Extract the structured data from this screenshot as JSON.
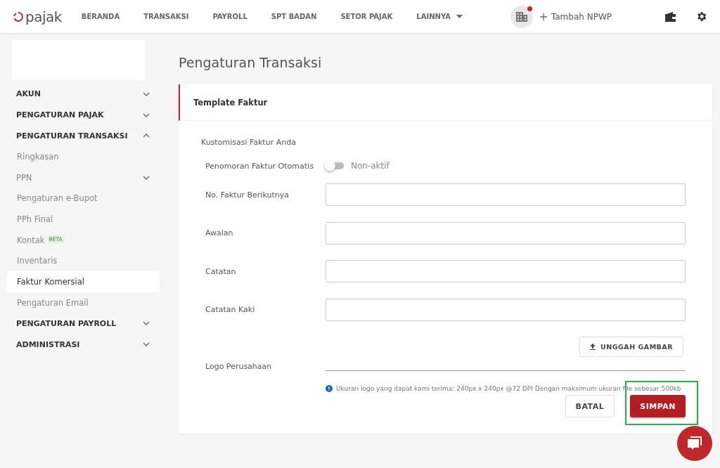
{
  "navbar": {
    "brand": "pajak",
    "menu": [
      {
        "label": "BERANDA",
        "dropdown": false
      },
      {
        "label": "TRANSAKSI",
        "dropdown": false
      },
      {
        "label": "PAYROLL",
        "dropdown": false
      },
      {
        "label": "SPT BADAN",
        "dropdown": false
      },
      {
        "label": "SETOR PAJAK",
        "dropdown": false
      },
      {
        "label": "LAINNYA",
        "dropdown": true
      }
    ],
    "notification": true,
    "add_npwp": "Tambah NPWP"
  },
  "sidebar": {
    "items": [
      {
        "kind": "section",
        "label": "AKUN",
        "expanded": false
      },
      {
        "kind": "section",
        "label": "PENGATURAN PAJAK",
        "expanded": false
      },
      {
        "kind": "section",
        "label": "PENGATURAN TRANSAKSI",
        "expanded": true,
        "children": [
          {
            "kind": "link",
            "label": "Ringkasan",
            "selected": false
          },
          {
            "kind": "group",
            "label": "PPN",
            "expanded": false
          },
          {
            "kind": "link",
            "label": "Pengaturan e-Bupot",
            "selected": false
          },
          {
            "kind": "link",
            "label": "PPh Final",
            "selected": false
          },
          {
            "kind": "link",
            "label": "Kontak",
            "badge": "BETA",
            "selected": false
          },
          {
            "kind": "link",
            "label": "Inventaris",
            "selected": false
          },
          {
            "kind": "link",
            "label": "Faktur Komersial",
            "selected": true
          },
          {
            "kind": "link",
            "label": "Pengaturan Email",
            "selected": false
          }
        ]
      },
      {
        "kind": "section",
        "label": "PENGATURAN PAYROLL",
        "expanded": false
      },
      {
        "kind": "section",
        "label": "ADMINISTRASI",
        "expanded": false
      }
    ]
  },
  "page_title": "Pengaturan Transaksi",
  "card": {
    "title": "Template Faktur",
    "subtitle": "Kustomisasi Faktur Anda",
    "toggle": {
      "label": "Penomoran Faktur Otomatis",
      "on": false,
      "status": "Non-aktif"
    },
    "fields": [
      {
        "kind": "text",
        "label": "No. Faktur Berikutnya"
      },
      {
        "kind": "text",
        "label": "Awalan"
      },
      {
        "kind": "text",
        "label": "Catatan"
      },
      {
        "kind": "text",
        "label": "Catatan Kaki"
      },
      {
        "kind": "upload",
        "label": "Logo Perusahaan",
        "button": "UNGGAH GAMBAR"
      }
    ],
    "info": "Ukuran logo yang dapat kami terima: 240px x 240px @72 DPI Dengan maksimum ukuran file sebesar 500kb",
    "buttons": [
      {
        "kind": "secondary",
        "label": "BATAL"
      },
      {
        "kind": "primary",
        "label": "SIMPAN"
      }
    ]
  }
}
